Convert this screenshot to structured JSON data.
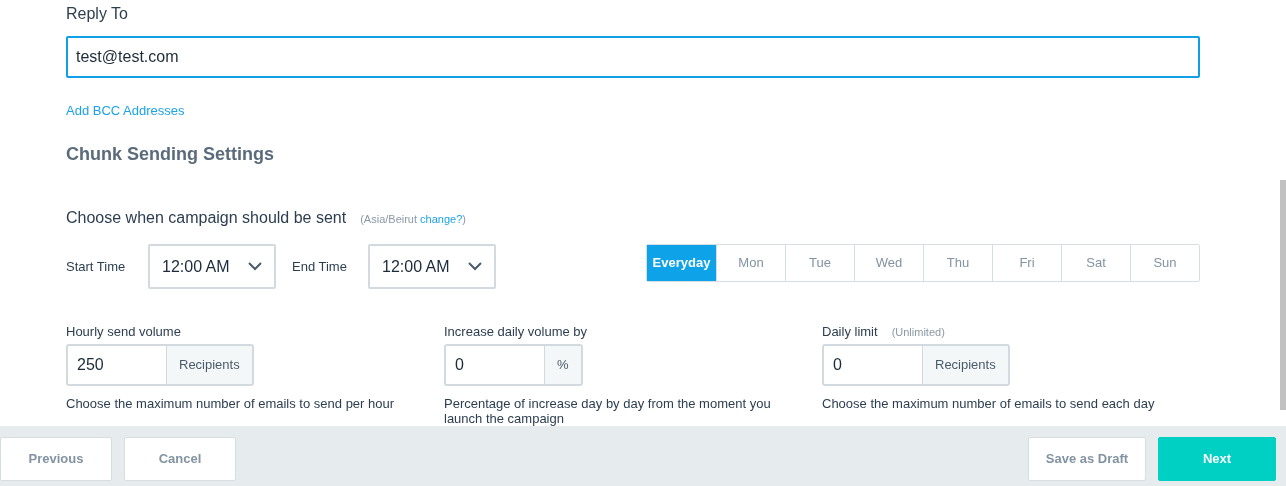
{
  "reply_to": {
    "label": "Reply To",
    "value": "test@test.com"
  },
  "add_bcc_link": "Add BCC Addresses",
  "section_title": "Chunk Sending Settings",
  "schedule": {
    "label": "Choose when campaign should be sent",
    "timezone_prefix": "(Asia/Beirut",
    "change_link": "change?",
    "timezone_suffix": ")",
    "start_label": "Start Time",
    "start_value": "12:00 AM",
    "end_label": "End Time",
    "end_value": "12:00 AM",
    "days": [
      {
        "label": "Everyday",
        "selected": true
      },
      {
        "label": "Mon",
        "selected": false
      },
      {
        "label": "Tue",
        "selected": false
      },
      {
        "label": "Wed",
        "selected": false
      },
      {
        "label": "Thu",
        "selected": false
      },
      {
        "label": "Fri",
        "selected": false
      },
      {
        "label": "Sat",
        "selected": false
      },
      {
        "label": "Sun",
        "selected": false
      }
    ]
  },
  "volume_fields": [
    {
      "label": "Hourly send volume",
      "value": "250",
      "unit": "Recipients",
      "help": "Choose the maximum number of emails to send per hour"
    },
    {
      "label": "Increase daily volume by",
      "value": "0",
      "unit": "%",
      "help": "Percentage of increase day by day from the moment you launch the campaign"
    },
    {
      "label": "Daily limit",
      "note": "(Unlimited)",
      "value": "0",
      "unit": "Recipients",
      "help": "Choose the maximum number of emails to send each day"
    }
  ],
  "footer": {
    "left_buttons": [
      {
        "label": "Previous"
      },
      {
        "label": "Cancel"
      }
    ],
    "right_buttons": [
      {
        "label": "Save as Draft",
        "kind": "secondary"
      },
      {
        "label": "Next",
        "kind": "primary"
      }
    ]
  }
}
